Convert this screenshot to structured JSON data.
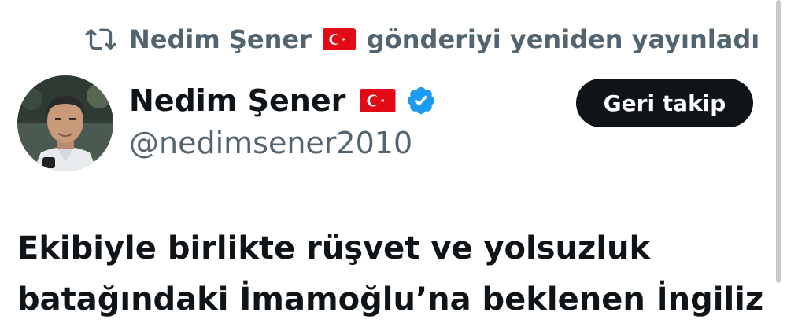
{
  "repost": {
    "icon": "repost-icon",
    "user": "Nedim Şener",
    "flag": "turkey-flag",
    "action": "gönderiyi yeniden yayınladı"
  },
  "author": {
    "name": "Nedim Şener",
    "handle": "@nedimsener2010",
    "flag": "turkey-flag",
    "verified": true,
    "verified_color": "#1d9bf0"
  },
  "follow_button": {
    "label": "Geri takip"
  },
  "post": {
    "lines": [
      "Ekibiyle birlikte rüşvet ve yolsuzluk",
      "batağındaki İmamoğlu’na beklenen İngiliz"
    ]
  },
  "colors": {
    "text": "#0f1419",
    "secondary": "#536471",
    "button_bg": "#0f1419",
    "flag_red": "#e30a17"
  }
}
